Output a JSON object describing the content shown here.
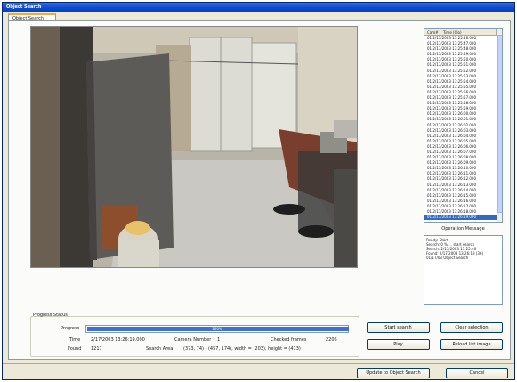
{
  "window": {
    "title": "Object Search"
  },
  "tabs": [
    {
      "label": "Object Search"
    }
  ],
  "result_list": {
    "columns": [
      "Cam#",
      "Time (Clo)"
    ],
    "rows": [
      "01  2/17/2003 13:25:46.000",
      "01  2/17/2003 13:25:47.000",
      "01  2/17/2003 13:25:48.000",
      "01  2/17/2003 13:25:49.000",
      "01  2/17/2003 13:25:50.000",
      "01  2/17/2003 13:25:51.000",
      "01  2/17/2003 13:25:52.000",
      "01  2/17/2003 13:25:53.000",
      "01  2/17/2003 13:25:54.000",
      "01  2/17/2003 13:25:55.000",
      "01  2/17/2003 13:25:56.000",
      "01  2/17/2003 13:25:57.000",
      "01  2/17/2003 13:25:58.000",
      "01  2/17/2003 13:25:59.000",
      "01  2/17/2003 13:26:00.000",
      "01  2/17/2003 13:26:01.000",
      "01  2/17/2003 13:26:02.000",
      "01  2/17/2003 13:26:03.000",
      "01  2/17/2003 13:26:04.000",
      "01  2/17/2003 13:26:05.000",
      "01  2/17/2003 13:26:06.000",
      "01  2/17/2003 13:26:07.000",
      "01  2/17/2003 13:26:08.000",
      "01  2/17/2003 13:26:09.000",
      "01  2/17/2003 13:26:10.000",
      "01  2/17/2003 13:26:11.000",
      "01  2/17/2003 13:26:12.000",
      "01  2/17/2003 13:26:13.000",
      "01  2/17/2003 13:26:14.000",
      "01  2/17/2003 13:26:15.000",
      "01  2/17/2003 13:26:16.000",
      "01  2/17/2003 13:26:17.000",
      "01  2/17/2003 13:26:18.000",
      "01  2/17/2003 13:26:19.000"
    ],
    "selected_index": 33
  },
  "operation": {
    "label": "Operation Message",
    "messages": [
      "Ready: Start",
      "Search: 0 %  ... start search",
      "Search: 2/17/2003 13:25:46",
      "Found: 2/17/2003 13:26:19 (36)",
      "01/17/03 Object Search"
    ]
  },
  "progress": {
    "group_label": "Progress Status",
    "progress_label": "Progress",
    "progress_text": "100%",
    "progress_fraction": 1.0,
    "time_label": "Time",
    "time_value": "2/17/2003 13:26:19.000",
    "camera_label": "Camera Number",
    "camera_value": "1",
    "checked_label": "Checked frames",
    "checked_value": "2206",
    "found_label": "Found",
    "found_value": "1217",
    "search_label": "Search Area",
    "search_value": "(373, 74) - (457, 174), width = (203), height = (413)"
  },
  "buttons": {
    "start_search": "Start search",
    "clear_selection": "Clear selection",
    "play": "Play",
    "reload_list_image": "Reload list image",
    "update_object_search": "Update to Object Search",
    "cancel": "Cancel"
  }
}
